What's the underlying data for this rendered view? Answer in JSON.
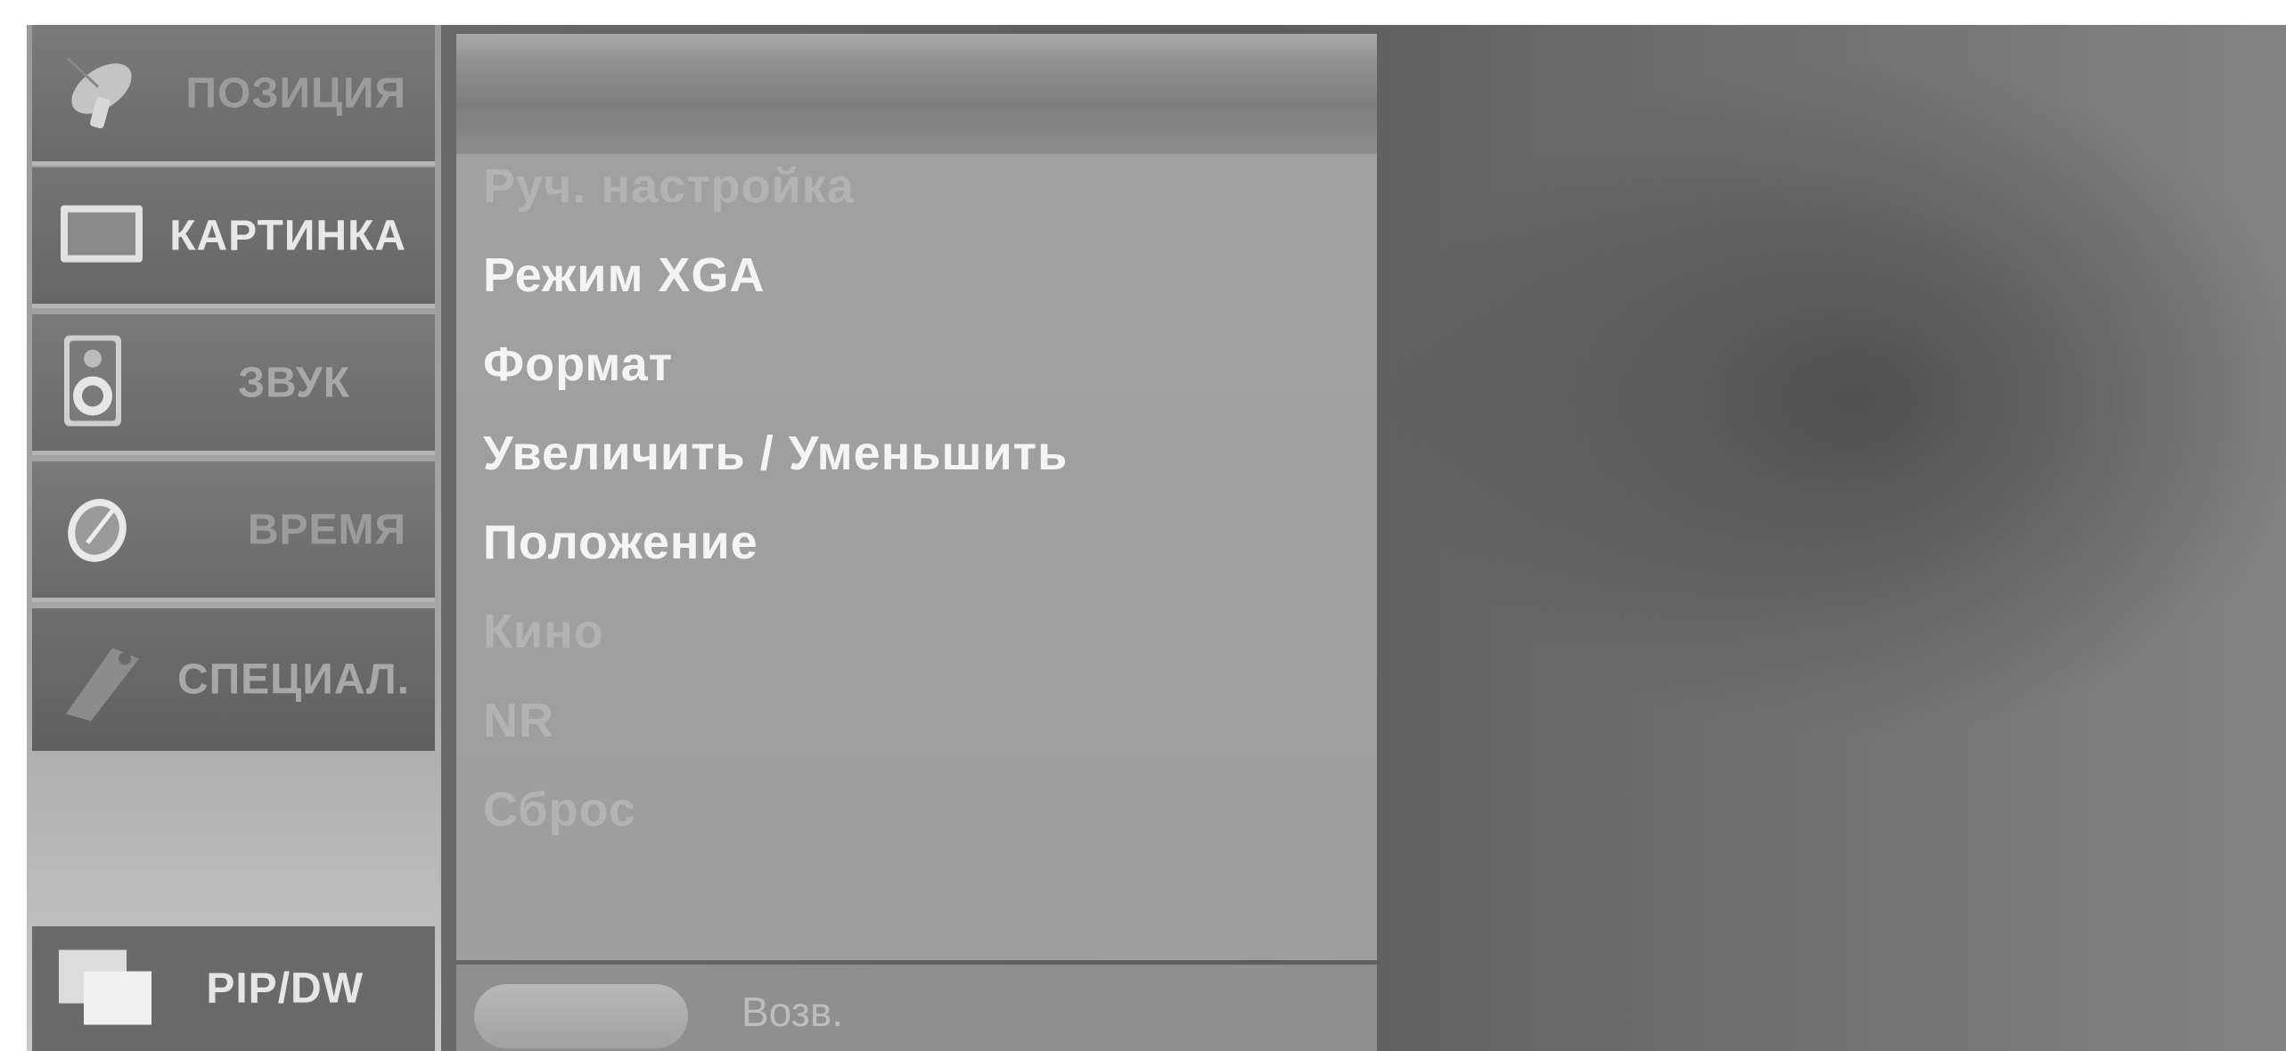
{
  "nav": {
    "items": [
      {
        "label": "ПОЗИЦИЯ",
        "icon": "satellite-dish-icon"
      },
      {
        "label": "КАРТИНКА",
        "icon": "tv-screen-icon"
      },
      {
        "label": "ЗВУК",
        "icon": "speaker-icon"
      },
      {
        "label": "ВРЕМЯ",
        "icon": "clock-icon"
      },
      {
        "label": "СПЕЦИАЛ.",
        "icon": "tag-icon"
      }
    ],
    "pip": {
      "label": "PIP/DW",
      "icon": "pip-windows-icon"
    }
  },
  "menu": {
    "items": [
      {
        "label": "Руч. настройка",
        "state": "inactive"
      },
      {
        "label": "Режим XGA",
        "state": "active"
      },
      {
        "label": "Формат",
        "state": "active"
      },
      {
        "label": "Увеличить / Уменьшить",
        "state": "active"
      },
      {
        "label": "Положение",
        "state": "active"
      },
      {
        "label": "Кино",
        "state": "inactive"
      },
      {
        "label": "NR",
        "state": "inactive"
      },
      {
        "label": "Сброс",
        "state": "inactive"
      }
    ]
  },
  "footer": {
    "back_label": "Возв."
  }
}
